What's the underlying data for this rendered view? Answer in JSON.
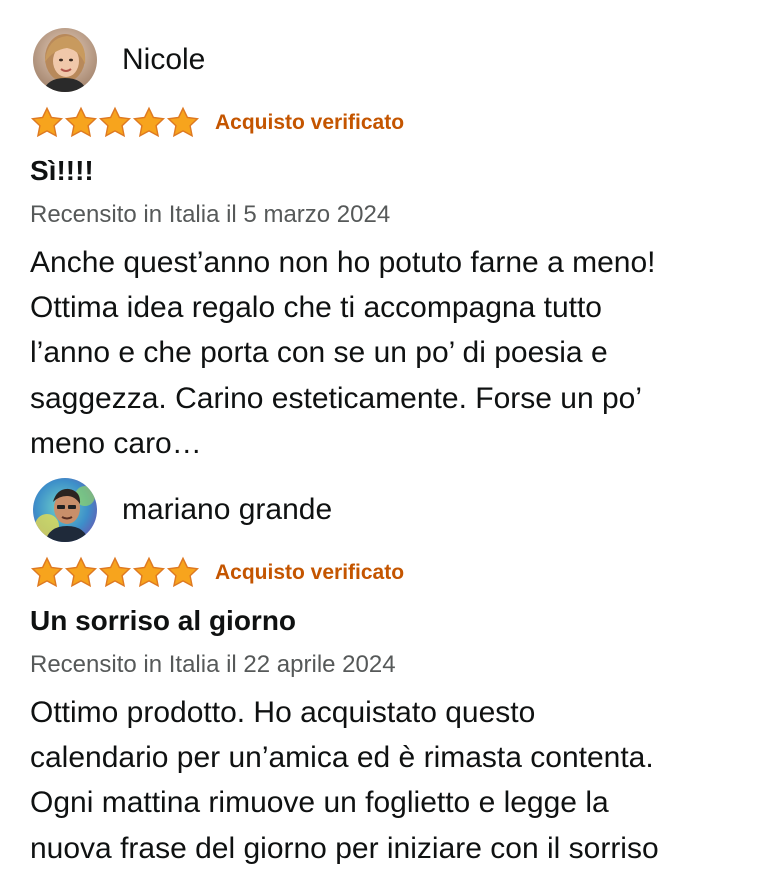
{
  "reviews": [
    {
      "reviewer": "Nicole",
      "rating": 5,
      "rating_max": 5,
      "verified_label": "Acquisto verificato",
      "title": "Sì!!!!",
      "date_text": "Recensito in Italia il 5 marzo 2024",
      "body_lines": [
        "Anche quest’anno non ho potuto farne a meno!",
        "Ottima idea regalo che ti accompagna tutto",
        "l’anno e che porta con se un po’ di poesia e",
        "saggezza. Carino esteticamente. Forse un po’",
        "meno caro…"
      ],
      "avatar_icon": "user-photo-icon"
    },
    {
      "reviewer": "mariano grande",
      "rating": 5,
      "rating_max": 5,
      "verified_label": "Acquisto verificato",
      "title": "Un sorriso al giorno",
      "date_text": "Recensito in Italia il 22 aprile 2024",
      "body_lines": [
        "Ottimo prodotto. Ho acquistato questo",
        "calendario per un’amica ed è rimasta contenta.",
        "Ogni mattina rimuove un foglietto e legge la",
        "nuova frase del giorno per iniziare con il sorriso"
      ],
      "avatar_icon": "user-photo-icon"
    }
  ],
  "colors": {
    "star_fill": "#f7a41d",
    "star_stroke": "#de7921",
    "verified": "#c45500",
    "text": "#0f1111",
    "muted": "#565959"
  }
}
